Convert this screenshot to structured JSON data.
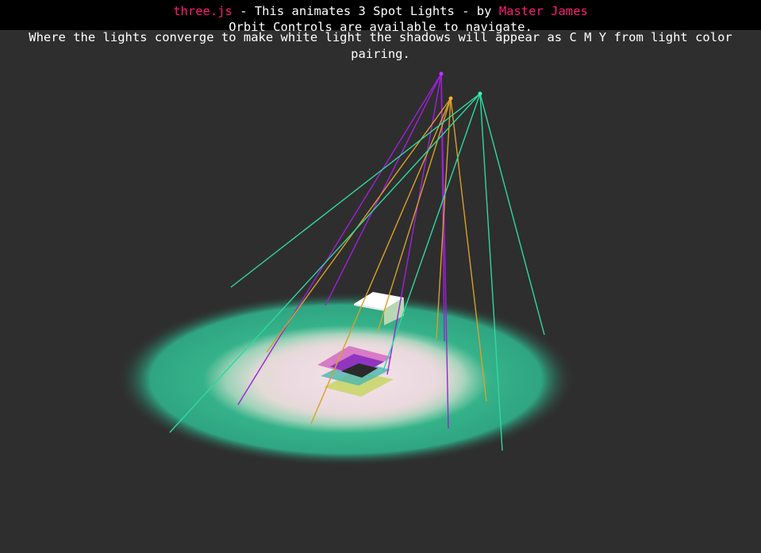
{
  "info": {
    "link_threejs": "three.js",
    "title_mid": " - This animates 3 Spot Lights - by ",
    "link_author": "Master James",
    "line2": "Orbit Controls are available to navigate.",
    "line3": "Where the lights converge to make white light the shadows will appear as C M Y from light color pairing."
  },
  "colors": {
    "background": "#2e2e2e",
    "header_band": "#000000",
    "link": "#ff1a7a",
    "text": "#ffffff",
    "magenta_light": "#b020e0",
    "orange_light": "#e0a020",
    "teal_light": "#30d8a0",
    "floor_glow": "#2fae86",
    "floor_core": "#f0dfe6"
  },
  "scene": {
    "objects": [
      "spotlight-magenta",
      "spotlight-orange",
      "spotlight-teal",
      "floor-plane",
      "cube",
      "shadow-planes"
    ]
  }
}
